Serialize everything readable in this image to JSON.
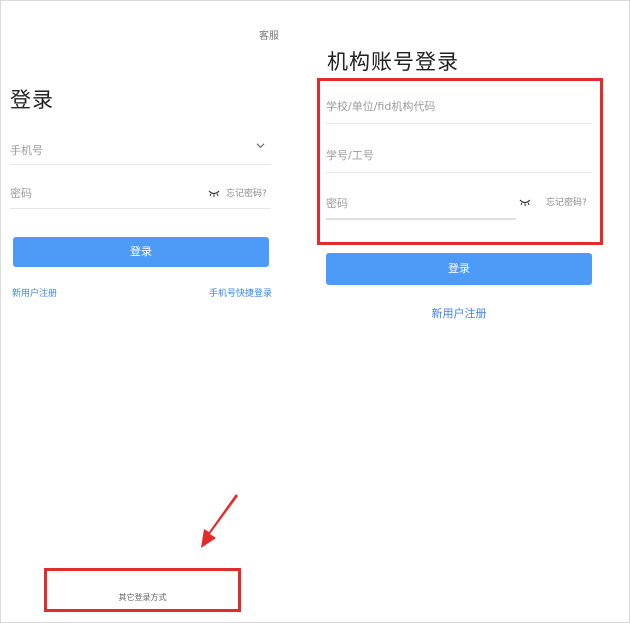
{
  "left": {
    "service": "客服",
    "title": "登录",
    "phone_placeholder": "手机号",
    "password_placeholder": "密码",
    "forgot": "忘记密码?",
    "login_button": "登录",
    "register": "新用户注册",
    "quick_login": "手机号快捷登录",
    "other_login": "其它登录方式"
  },
  "right": {
    "title": "机构账号登录",
    "org_placeholder": "学校/单位/fid机构代码",
    "id_placeholder": "学号/工号",
    "password_placeholder": "密码",
    "forgot": "忘记密码?",
    "login_button": "登录",
    "register": "新用户注册"
  },
  "colors": {
    "accent": "#4d9bf7",
    "link": "#3d86e8",
    "highlight": "#e32b2b"
  },
  "icons": [
    "chevron-down-icon",
    "eye-closed-icon",
    "arrow-icon"
  ]
}
